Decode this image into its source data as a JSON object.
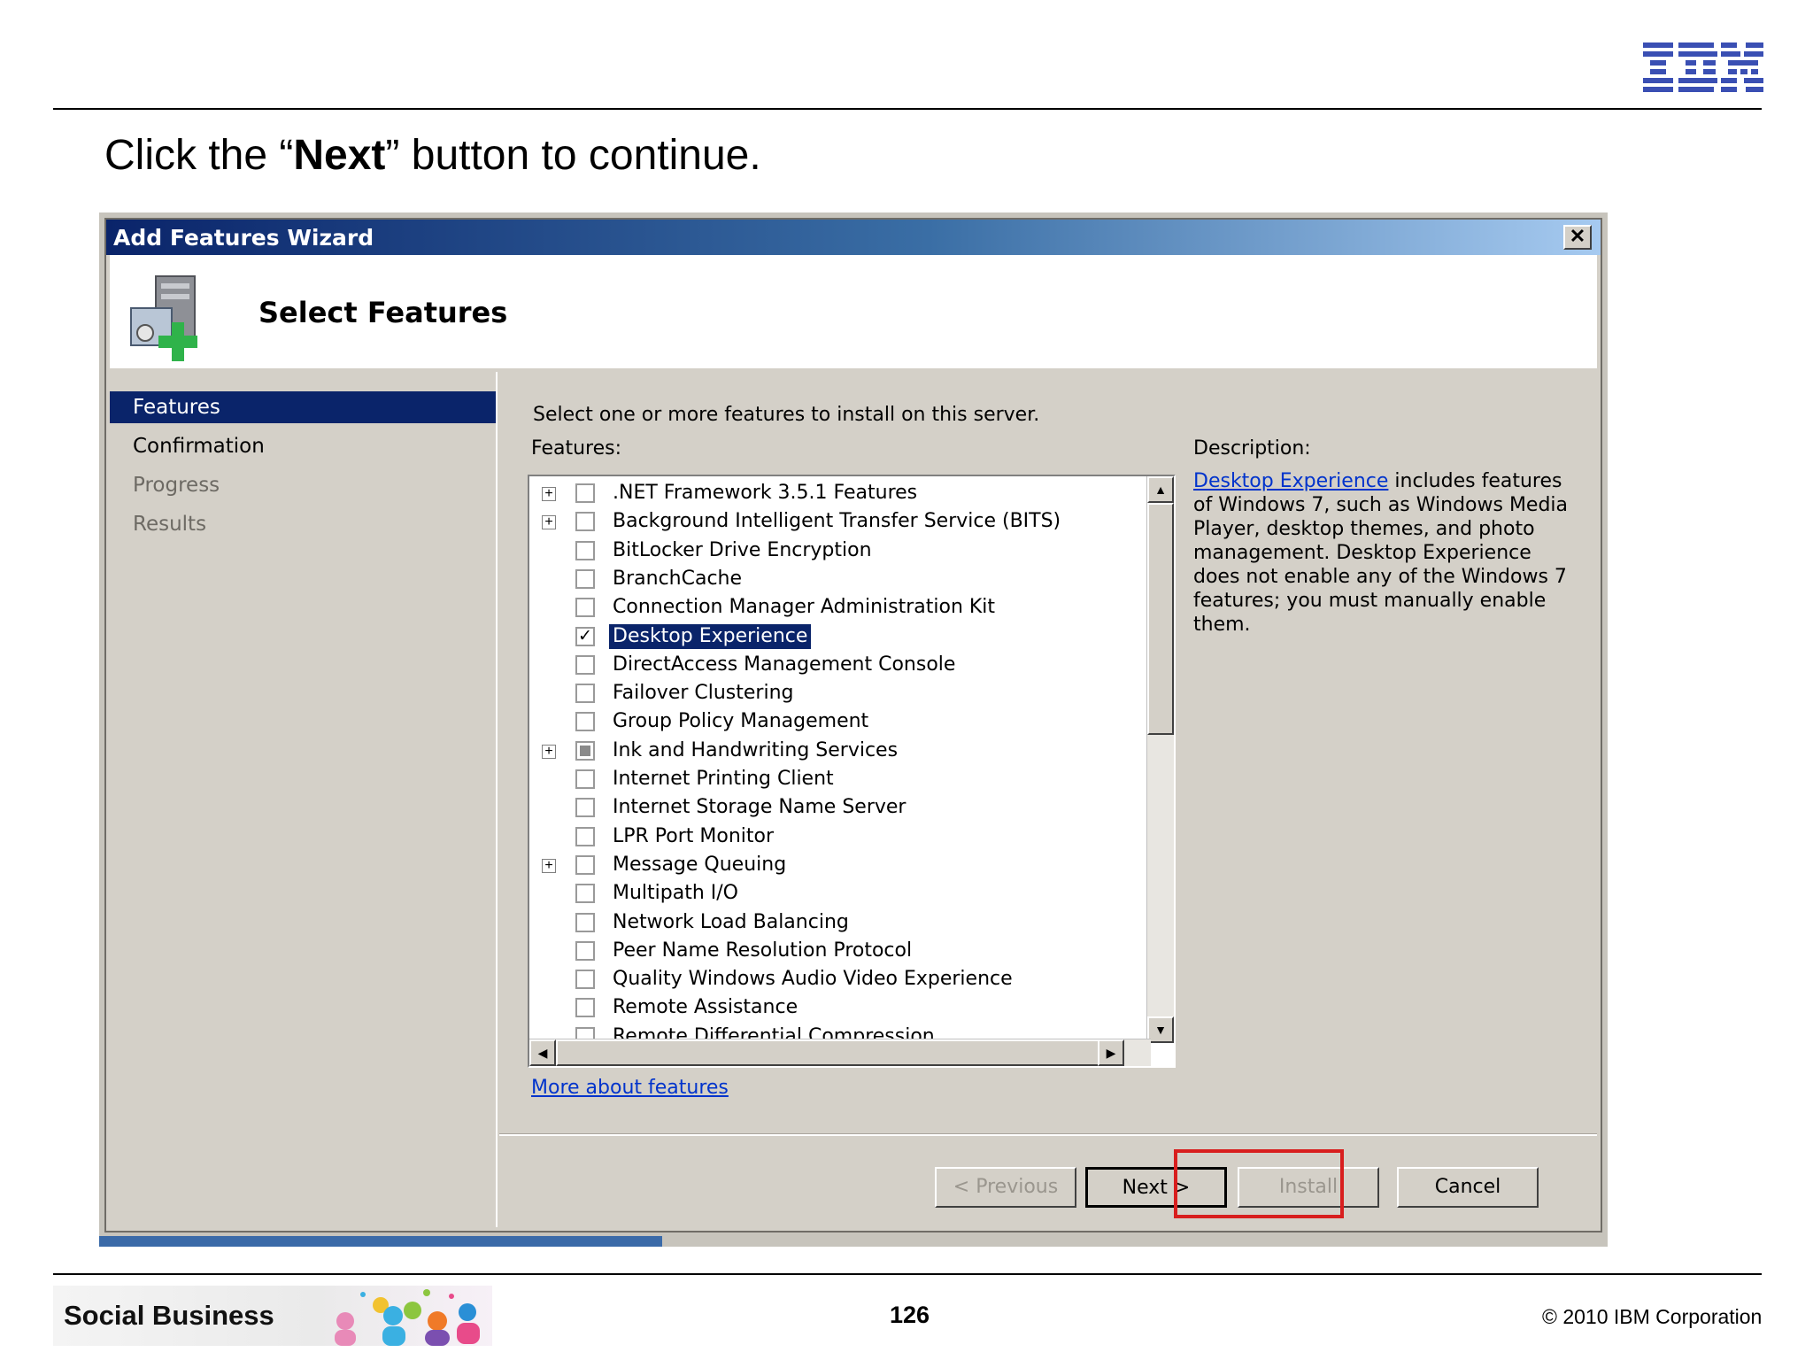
{
  "slide": {
    "instruction_prefix": "Click the “",
    "instruction_bold": "Next",
    "instruction_suffix": "” button to continue.",
    "footer_brand": "Social Business",
    "page_number": "126",
    "copyright": "© 2010 IBM Corporation",
    "logo_text": "IBM"
  },
  "window": {
    "title": "Add Features Wizard",
    "close_glyph": "✕",
    "header_title": "Select Features"
  },
  "nav": {
    "items": [
      {
        "label": "Features",
        "state": "selected"
      },
      {
        "label": "Confirmation",
        "state": "normal"
      },
      {
        "label": "Progress",
        "state": "disabled"
      },
      {
        "label": "Results",
        "state": "disabled"
      }
    ]
  },
  "content": {
    "prompt": "Select one or more features to install on this server.",
    "features_label": "Features:",
    "description_label": "Description:",
    "description_link": "Desktop Experience",
    "description_body": " includes features of Windows 7, such as Windows Media Player, desktop themes, and photo management. Desktop Experience does not enable any of the Windows 7 features; you must manually enable them.",
    "more_link": "More about features",
    "features": [
      {
        "label": ".NET Framework 3.5.1 Features",
        "expandable": true,
        "checked": "none"
      },
      {
        "label": "Background Intelligent Transfer Service (BITS)",
        "expandable": true,
        "checked": "none"
      },
      {
        "label": "BitLocker Drive Encryption",
        "expandable": false,
        "checked": "none"
      },
      {
        "label": "BranchCache",
        "expandable": false,
        "checked": "none"
      },
      {
        "label": "Connection Manager Administration Kit",
        "expandable": false,
        "checked": "none"
      },
      {
        "label": "Desktop Experience",
        "expandable": false,
        "checked": "checked",
        "selected": true
      },
      {
        "label": "DirectAccess Management Console",
        "expandable": false,
        "checked": "none"
      },
      {
        "label": "Failover Clustering",
        "expandable": false,
        "checked": "none"
      },
      {
        "label": "Group Policy Management",
        "expandable": false,
        "checked": "none"
      },
      {
        "label": "Ink and Handwriting Services",
        "expandable": true,
        "checked": "partial"
      },
      {
        "label": "Internet Printing Client",
        "expandable": false,
        "checked": "none"
      },
      {
        "label": "Internet Storage Name Server",
        "expandable": false,
        "checked": "none"
      },
      {
        "label": "LPR Port Monitor",
        "expandable": false,
        "checked": "none"
      },
      {
        "label": "Message Queuing",
        "expandable": true,
        "checked": "none"
      },
      {
        "label": "Multipath I/O",
        "expandable": false,
        "checked": "none"
      },
      {
        "label": "Network Load Balancing",
        "expandable": false,
        "checked": "none"
      },
      {
        "label": "Peer Name Resolution Protocol",
        "expandable": false,
        "checked": "none"
      },
      {
        "label": "Quality Windows Audio Video Experience",
        "expandable": false,
        "checked": "none"
      },
      {
        "label": "Remote Assistance",
        "expandable": false,
        "checked": "none"
      },
      {
        "label": "Remote Differential Compression",
        "expandable": false,
        "checked": "none"
      }
    ]
  },
  "buttons": {
    "previous": "< Previous",
    "next": "Next >",
    "install": "Install",
    "cancel": "Cancel"
  },
  "colors": {
    "highlight": "#d81e1e",
    "selection": "#0a246a",
    "link": "#0033cc"
  }
}
